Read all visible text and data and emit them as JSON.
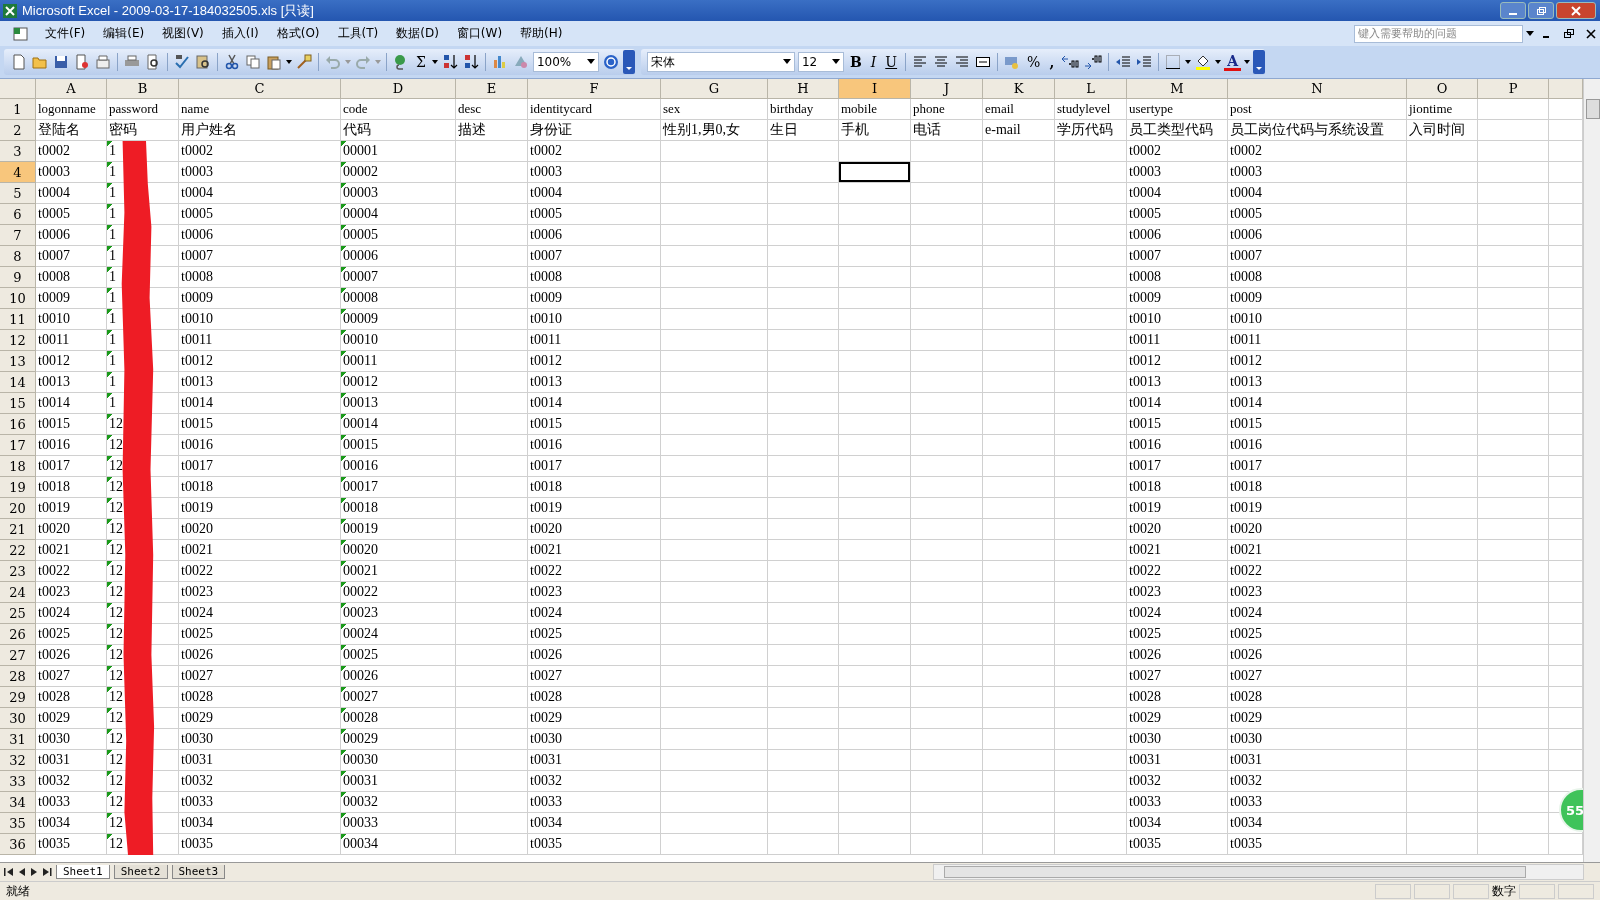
{
  "window": {
    "title": "Microsoft Excel - 2009-03-17-184032505.xls  [只读]"
  },
  "menu": [
    {
      "label": "文件(F)"
    },
    {
      "label": "编辑(E)"
    },
    {
      "label": "视图(V)"
    },
    {
      "label": "插入(I)"
    },
    {
      "label": "格式(O)"
    },
    {
      "label": "工具(T)"
    },
    {
      "label": "数据(D)"
    },
    {
      "label": "窗口(W)"
    },
    {
      "label": "帮助(H)"
    }
  ],
  "help_search": {
    "placeholder": "键入需要帮助的问题"
  },
  "toolbar": {
    "sum": "Σ",
    "zoom": "100%",
    "font": "宋体",
    "size": "12",
    "bold": "B",
    "italic": "I",
    "underline": "U",
    "percent": "%",
    "comma": ",",
    "font_color": "A"
  },
  "columns": [
    {
      "letter": "A",
      "selected": false,
      "error_indicator": false
    },
    {
      "letter": "B",
      "selected": false,
      "error_indicator": true
    },
    {
      "letter": "C",
      "selected": false,
      "error_indicator": false
    },
    {
      "letter": "D",
      "selected": false,
      "error_indicator": true
    },
    {
      "letter": "E",
      "selected": false,
      "error_indicator": false
    },
    {
      "letter": "F",
      "selected": false,
      "error_indicator": false
    },
    {
      "letter": "G",
      "selected": false,
      "error_indicator": false
    },
    {
      "letter": "H",
      "selected": false,
      "error_indicator": false
    },
    {
      "letter": "I",
      "selected": true,
      "error_indicator": false
    },
    {
      "letter": "J",
      "selected": false,
      "error_indicator": false
    },
    {
      "letter": "K",
      "selected": false,
      "error_indicator": false
    },
    {
      "letter": "L",
      "selected": false,
      "error_indicator": false
    },
    {
      "letter": "M",
      "selected": false,
      "error_indicator": false
    },
    {
      "letter": "N",
      "selected": false,
      "error_indicator": false
    },
    {
      "letter": "O",
      "selected": false,
      "error_indicator": false
    },
    {
      "letter": "P",
      "selected": false,
      "error_indicator": false
    }
  ],
  "rows": [
    {
      "number": "1",
      "kind": "field-names",
      "selected": false,
      "cells": {
        "A": "logonname",
        "B": "password",
        "C": "name",
        "D": "code",
        "E": "desc",
        "F": "identitycard",
        "G": "sex",
        "H": "birthday",
        "I": "mobile",
        "J": "phone",
        "K": "email",
        "L": "studylevel",
        "M": "usertype",
        "N": "post",
        "O": "jiontime"
      }
    },
    {
      "number": "2",
      "kind": "captions",
      "selected": false,
      "cells": {
        "A": "登陆名",
        "B": "密码",
        "C": "用户姓名",
        "D": "代码",
        "E": "描述",
        "F": "身份证",
        "G": "性别1,男0,女",
        "H": "生日",
        "I": "手机",
        "J": "电话",
        "K": "e-mail",
        "L": "学历代码",
        "M": "员工类型代码",
        "N": "员工岗位代码与系统设置",
        "O": "入司时间"
      }
    },
    {
      "number": "3",
      "kind": "data",
      "selected": false,
      "cells": {
        "A": "t0002",
        "B": "1",
        "C": "t0002",
        "D": "00001",
        "F": "t0002",
        "M": "t0002",
        "N": "t0002"
      }
    },
    {
      "number": "4",
      "kind": "data",
      "selected": true,
      "cells": {
        "A": "t0003",
        "B": "1",
        "C": "t0003",
        "D": "00002",
        "F": "t0003",
        "M": "t0003",
        "N": "t0003"
      }
    },
    {
      "number": "5",
      "kind": "data",
      "selected": false,
      "cells": {
        "A": "t0004",
        "B": "1",
        "C": "t0004",
        "D": "00003",
        "F": "t0004",
        "M": "t0004",
        "N": "t0004"
      }
    },
    {
      "number": "6",
      "kind": "data",
      "selected": false,
      "cells": {
        "A": "t0005",
        "B": "1",
        "C": "t0005",
        "D": "00004",
        "F": "t0005",
        "M": "t0005",
        "N": "t0005"
      }
    },
    {
      "number": "7",
      "kind": "data",
      "selected": false,
      "cells": {
        "A": "t0006",
        "B": "1",
        "C": "t0006",
        "D": "00005",
        "F": "t0006",
        "M": "t0006",
        "N": "t0006"
      }
    },
    {
      "number": "8",
      "kind": "data",
      "selected": false,
      "cells": {
        "A": "t0007",
        "B": "1",
        "C": "t0007",
        "D": "00006",
        "F": "t0007",
        "M": "t0007",
        "N": "t0007"
      }
    },
    {
      "number": "9",
      "kind": "data",
      "selected": false,
      "cells": {
        "A": "t0008",
        "B": "1",
        "C": "t0008",
        "D": "00007",
        "F": "t0008",
        "M": "t0008",
        "N": "t0008"
      }
    },
    {
      "number": "10",
      "kind": "data",
      "selected": false,
      "cells": {
        "A": "t0009",
        "B": "1",
        "C": "t0009",
        "D": "00008",
        "F": "t0009",
        "M": "t0009",
        "N": "t0009"
      }
    },
    {
      "number": "11",
      "kind": "data",
      "selected": false,
      "cells": {
        "A": "t0010",
        "B": "1",
        "C": "t0010",
        "D": "00009",
        "F": "t0010",
        "M": "t0010",
        "N": "t0010"
      }
    },
    {
      "number": "12",
      "kind": "data",
      "selected": false,
      "cells": {
        "A": "t0011",
        "B": "1",
        "C": "t0011",
        "D": "00010",
        "F": "t0011",
        "M": "t0011",
        "N": "t0011"
      }
    },
    {
      "number": "13",
      "kind": "data",
      "selected": false,
      "cells": {
        "A": "t0012",
        "B": "1",
        "C": "t0012",
        "D": "00011",
        "F": "t0012",
        "M": "t0012",
        "N": "t0012"
      }
    },
    {
      "number": "14",
      "kind": "data",
      "selected": false,
      "cells": {
        "A": "t0013",
        "B": "1",
        "C": "t0013",
        "D": "00012",
        "F": "t0013",
        "M": "t0013",
        "N": "t0013"
      }
    },
    {
      "number": "15",
      "kind": "data",
      "selected": false,
      "cells": {
        "A": "t0014",
        "B": "1",
        "C": "t0014",
        "D": "00013",
        "F": "t0014",
        "M": "t0014",
        "N": "t0014"
      }
    },
    {
      "number": "16",
      "kind": "data",
      "selected": false,
      "cells": {
        "A": "t0015",
        "B": "12",
        "C": "t0015",
        "D": "00014",
        "F": "t0015",
        "M": "t0015",
        "N": "t0015"
      }
    },
    {
      "number": "17",
      "kind": "data",
      "selected": false,
      "cells": {
        "A": "t0016",
        "B": "12",
        "C": "t0016",
        "D": "00015",
        "F": "t0016",
        "M": "t0016",
        "N": "t0016"
      }
    },
    {
      "number": "18",
      "kind": "data",
      "selected": false,
      "cells": {
        "A": "t0017",
        "B": "12",
        "C": "t0017",
        "D": "00016",
        "F": "t0017",
        "M": "t0017",
        "N": "t0017"
      }
    },
    {
      "number": "19",
      "kind": "data",
      "selected": false,
      "cells": {
        "A": "t0018",
        "B": "12",
        "C": "t0018",
        "D": "00017",
        "F": "t0018",
        "M": "t0018",
        "N": "t0018"
      }
    },
    {
      "number": "20",
      "kind": "data",
      "selected": false,
      "cells": {
        "A": "t0019",
        "B": "12",
        "C": "t0019",
        "D": "00018",
        "F": "t0019",
        "M": "t0019",
        "N": "t0019"
      }
    },
    {
      "number": "21",
      "kind": "data",
      "selected": false,
      "cells": {
        "A": "t0020",
        "B": "12",
        "C": "t0020",
        "D": "00019",
        "F": "t0020",
        "M": "t0020",
        "N": "t0020"
      }
    },
    {
      "number": "22",
      "kind": "data",
      "selected": false,
      "cells": {
        "A": "t0021",
        "B": "12",
        "C": "t0021",
        "D": "00020",
        "F": "t0021",
        "M": "t0021",
        "N": "t0021"
      }
    },
    {
      "number": "23",
      "kind": "data",
      "selected": false,
      "cells": {
        "A": "t0022",
        "B": "12",
        "C": "t0022",
        "D": "00021",
        "F": "t0022",
        "M": "t0022",
        "N": "t0022"
      }
    },
    {
      "number": "24",
      "kind": "data",
      "selected": false,
      "cells": {
        "A": "t0023",
        "B": "12",
        "C": "t0023",
        "D": "00022",
        "F": "t0023",
        "M": "t0023",
        "N": "t0023"
      }
    },
    {
      "number": "25",
      "kind": "data",
      "selected": false,
      "cells": {
        "A": "t0024",
        "B": "12",
        "C": "t0024",
        "D": "00023",
        "F": "t0024",
        "M": "t0024",
        "N": "t0024"
      }
    },
    {
      "number": "26",
      "kind": "data",
      "selected": false,
      "cells": {
        "A": "t0025",
        "B": "12",
        "C": "t0025",
        "D": "00024",
        "F": "t0025",
        "M": "t0025",
        "N": "t0025"
      }
    },
    {
      "number": "27",
      "kind": "data",
      "selected": false,
      "cells": {
        "A": "t0026",
        "B": "12",
        "C": "t0026",
        "D": "00025",
        "F": "t0026",
        "M": "t0026",
        "N": "t0026"
      }
    },
    {
      "number": "28",
      "kind": "data",
      "selected": false,
      "cells": {
        "A": "t0027",
        "B": "12",
        "C": "t0027",
        "D": "00026",
        "F": "t0027",
        "M": "t0027",
        "N": "t0027"
      }
    },
    {
      "number": "29",
      "kind": "data",
      "selected": false,
      "cells": {
        "A": "t0028",
        "B": "12",
        "C": "t0028",
        "D": "00027",
        "F": "t0028",
        "M": "t0028",
        "N": "t0028"
      }
    },
    {
      "number": "30",
      "kind": "data",
      "selected": false,
      "cells": {
        "A": "t0029",
        "B": "12",
        "C": "t0029",
        "D": "00028",
        "F": "t0029",
        "M": "t0029",
        "N": "t0029"
      }
    },
    {
      "number": "31",
      "kind": "data",
      "selected": false,
      "cells": {
        "A": "t0030",
        "B": "12",
        "C": "t0030",
        "D": "00029",
        "F": "t0030",
        "M": "t0030",
        "N": "t0030"
      }
    },
    {
      "number": "32",
      "kind": "data",
      "selected": false,
      "cells": {
        "A": "t0031",
        "B": "12",
        "C": "t0031",
        "D": "00030",
        "F": "t0031",
        "M": "t0031",
        "N": "t0031"
      }
    },
    {
      "number": "33",
      "kind": "data",
      "selected": false,
      "cells": {
        "A": "t0032",
        "B": "12",
        "C": "t0032",
        "D": "00031",
        "F": "t0032",
        "M": "t0032",
        "N": "t0032"
      }
    },
    {
      "number": "34",
      "kind": "data",
      "selected": false,
      "cells": {
        "A": "t0033",
        "B": "12",
        "C": "t0033",
        "D": "00032",
        "F": "t0033",
        "M": "t0033",
        "N": "t0033"
      }
    },
    {
      "number": "35",
      "kind": "data",
      "selected": false,
      "cells": {
        "A": "t0034",
        "B": "12",
        "C": "t0034",
        "D": "00033",
        "F": "t0034",
        "M": "t0034",
        "N": "t0034"
      }
    },
    {
      "number": "36",
      "kind": "data",
      "selected": false,
      "cells": {
        "A": "t0035",
        "B": "12",
        "C": "t0035",
        "D": "00034",
        "F": "t0035",
        "M": "t0035",
        "N": "t0035"
      }
    }
  ],
  "sheet_tabs": [
    {
      "label": "Sheet1",
      "selected": true
    },
    {
      "label": "Sheet2",
      "selected": false
    },
    {
      "label": "Sheet3",
      "selected": false
    }
  ],
  "status_bar": {
    "status": "就绪",
    "mode": "数字"
  },
  "floating_badge": {
    "count": "55"
  }
}
